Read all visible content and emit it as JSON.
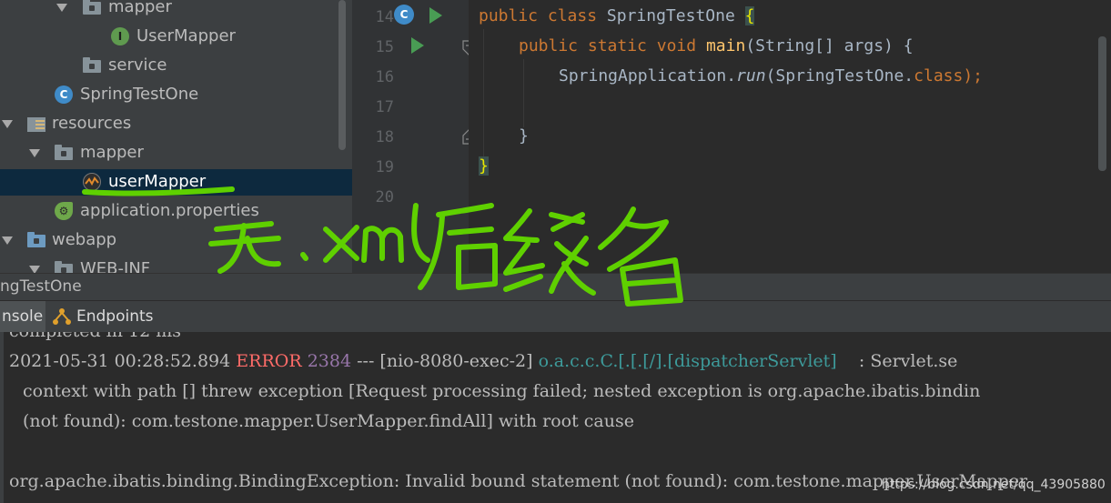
{
  "project_tree": {
    "items": [
      {
        "label": "mapper",
        "icon": "package-folder-icon"
      },
      {
        "label": "UserMapper",
        "icon": "interface-icon"
      },
      {
        "label": "service",
        "icon": "package-folder-icon"
      },
      {
        "label": "SpringTestOne",
        "icon": "spring-boot-class-icon"
      },
      {
        "label": "resources",
        "icon": "resources-folder-icon"
      },
      {
        "label": "mapper",
        "icon": "folder-icon"
      },
      {
        "label": "userMapper",
        "icon": "mybatis-file-icon"
      },
      {
        "label": "application.properties",
        "icon": "spring-properties-icon"
      },
      {
        "label": "webapp",
        "icon": "web-folder-icon"
      },
      {
        "label": "WEB-INF",
        "icon": "folder-icon"
      }
    ]
  },
  "editor": {
    "line_numbers": [
      "14",
      "15",
      "16",
      "17",
      "18",
      "19",
      "20"
    ],
    "lines": {
      "l14": {
        "kw1": "public",
        "kw2": "class",
        "name": "SpringTestOne",
        "brace": "{"
      },
      "l15": {
        "kw1": "public",
        "kw2": "static",
        "kw3": "void",
        "fn": "main",
        "args": "(String[] args) {"
      },
      "l16": {
        "obj": "SpringApplication.",
        "call": "run",
        "open": "(SpringTestOne.",
        "kw": "class",
        "close": ");"
      },
      "l18": {
        "text": "}"
      },
      "l19": {
        "text": "}"
      }
    }
  },
  "run_window": {
    "title": "ngTestOne",
    "tabs": {
      "console": "nsole",
      "endpoints": "Endpoints"
    }
  },
  "console": {
    "partial_top": "completed in 12 ms",
    "log": {
      "timestamp": "2021-05-31 00:28:52.894",
      "level": "ERROR",
      "pid": "2384",
      "sep": "---",
      "thread": "[nio-8080-exec-2]",
      "logger": "o.a.c.c.C.[.[.[/].[dispatcherServlet]",
      "message": ": Servlet.se"
    },
    "line2": "context with path [] threw exception [Request processing failed; nested exception is org.apache.ibatis.bindin",
    "line3": "(not found): com.testone.mapper.UserMapper.findAll] with root cause",
    "line4": "org.apache.ibatis.binding.BindingException: Invalid bound statement (not found): com.testone.mapper.UserMapper"
  },
  "annotation": {
    "text": "无.xml后缀名",
    "color": "#5fd000"
  },
  "watermark": "https://blog.csdn.net/qq_43905880"
}
